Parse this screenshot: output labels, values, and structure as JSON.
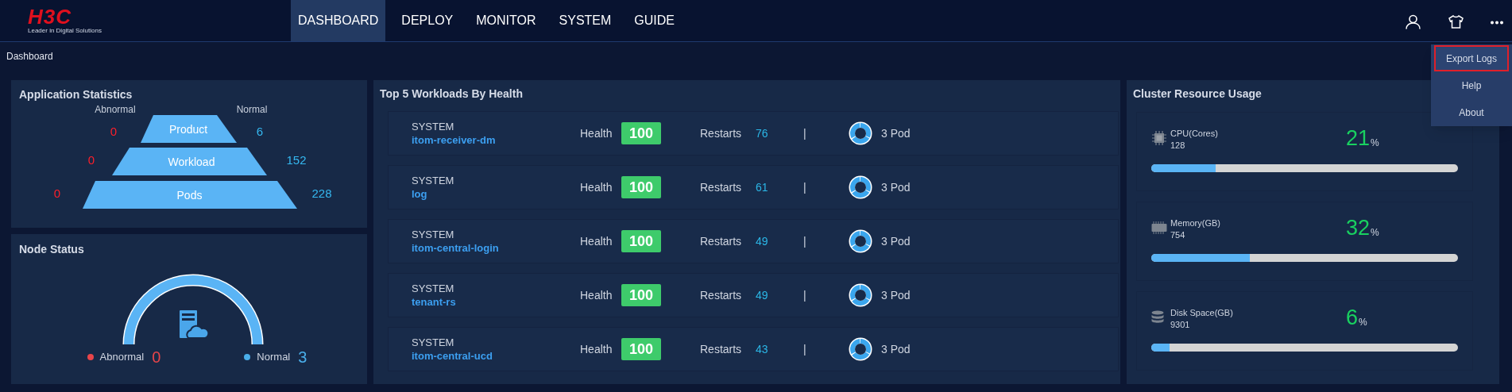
{
  "header": {
    "logo": {
      "mark": "H3C",
      "tagline": "Leader in Digital Solutions"
    },
    "nav": [
      {
        "label": "DASHBOARD",
        "selected": true
      },
      {
        "label": "DEPLOY",
        "selected": false
      },
      {
        "label": "MONITOR",
        "selected": false
      },
      {
        "label": "SYSTEM",
        "selected": false
      },
      {
        "label": "GUIDE",
        "selected": false
      }
    ]
  },
  "breadcrumb": "Dashboard",
  "more_menu": {
    "items": [
      {
        "label": "Export Logs",
        "selected": true
      },
      {
        "label": "Help",
        "selected": false
      },
      {
        "label": "About",
        "selected": false
      }
    ]
  },
  "application_statistics": {
    "title": "Application Statistics",
    "abnormal_label": "Abnormal",
    "normal_label": "Normal",
    "tiers": [
      {
        "label": "Product",
        "abnormal": "0",
        "normal": "6"
      },
      {
        "label": "Workload",
        "abnormal": "0",
        "normal": "152"
      },
      {
        "label": "Pods",
        "abnormal": "0",
        "normal": "228"
      }
    ]
  },
  "node_status": {
    "title": "Node Status",
    "legend": [
      {
        "label": "Abnormal",
        "count": "0",
        "color": "#e8454a"
      },
      {
        "label": "Normal",
        "count": "3",
        "color": "#4aaeea"
      }
    ]
  },
  "workloads": {
    "title": "Top 5 Workloads By Health",
    "rows": [
      {
        "namespace": "SYSTEM",
        "name": "itom-receiver-dm",
        "health_label": "Health",
        "health": "100",
        "restarts_label": "Restarts",
        "restarts": "76",
        "separator": "|",
        "pods": "3 Pod"
      },
      {
        "namespace": "SYSTEM",
        "name": "log",
        "health_label": "Health",
        "health": "100",
        "restarts_label": "Restarts",
        "restarts": "61",
        "separator": "|",
        "pods": "3 Pod"
      },
      {
        "namespace": "SYSTEM",
        "name": "itom-central-login",
        "health_label": "Health",
        "health": "100",
        "restarts_label": "Restarts",
        "restarts": "49",
        "separator": "|",
        "pods": "3 Pod"
      },
      {
        "namespace": "SYSTEM",
        "name": "tenant-rs",
        "health_label": "Health",
        "health": "100",
        "restarts_label": "Restarts",
        "restarts": "49",
        "separator": "|",
        "pods": "3 Pod"
      },
      {
        "namespace": "SYSTEM",
        "name": "itom-central-ucd",
        "health_label": "Health",
        "health": "100",
        "restarts_label": "Restarts",
        "restarts": "43",
        "separator": "|",
        "pods": "3 Pod"
      }
    ]
  },
  "cluster_resource_usage": {
    "title": "Cluster Resource Usage",
    "resources": [
      {
        "kind": "cpu",
        "label": "CPU(Cores)",
        "total": "128",
        "percent": "21",
        "unit": "%",
        "level": 0.21
      },
      {
        "kind": "memory",
        "label": "Memory(GB)",
        "total": "754",
        "percent": "32",
        "unit": "%",
        "level": 0.32
      },
      {
        "kind": "disk",
        "label": "Disk Space(GB)",
        "total": "9301",
        "percent": "6",
        "unit": "%",
        "level": 0.06
      }
    ]
  }
}
